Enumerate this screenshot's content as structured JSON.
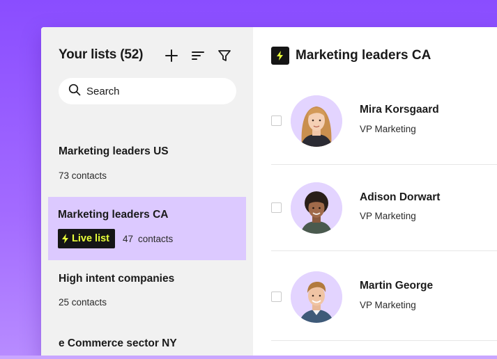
{
  "sidebar": {
    "title": "Your lists (52)",
    "search_placeholder": "Search",
    "lists": [
      {
        "name": "Marketing leaders US",
        "count": "73 contacts"
      },
      {
        "name": "Marketing leaders CA",
        "badge": "Live list",
        "count_number": "47",
        "count_label": "contacts"
      },
      {
        "name": "High intent companies",
        "count": "25 contacts"
      },
      {
        "name": "e Commerce sector NY"
      }
    ]
  },
  "main": {
    "title": "Marketing leaders CA",
    "contacts": [
      {
        "name": "Mira Korsgaard",
        "role": "VP Marketing"
      },
      {
        "name": "Adison Dorwart",
        "role": "VP Marketing"
      },
      {
        "name": "Martin George",
        "role": "VP Marketing"
      }
    ]
  },
  "colors": {
    "background": "#8a4dff",
    "selected_list": "#dcc9ff",
    "badge_bg": "#151515",
    "badge_text": "#e8ff3a",
    "avatar_bg": "#e3d4ff"
  }
}
